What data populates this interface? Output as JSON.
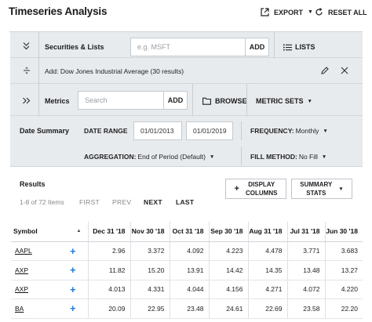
{
  "header": {
    "title": "Timeseries Analysis",
    "export_label": "EXPORT",
    "reset_label": "RESET ALL"
  },
  "securities": {
    "label": "Securities & Lists",
    "input_placeholder": "e.g. MSFT",
    "add_label": "ADD",
    "lists_label": "LISTS",
    "added_text": "Add: Dow Jones Industrial Average (30 results)"
  },
  "metrics": {
    "label": "Metrics",
    "search_placeholder": "Search",
    "add_label": "ADD",
    "browse_label": "BROWSE",
    "metric_sets_label": "METRIC SETS"
  },
  "date_summary": {
    "label": "Date Summary",
    "date_range_label": "DATE RANGE",
    "start_date": "01/01/2013",
    "end_date": "01/01/2019",
    "frequency_label": "FREQUENCY:",
    "frequency_value": "Monthly",
    "aggregation_label": "AGGREGATION:",
    "aggregation_value": "End of Period (Default)",
    "fill_method_label": "FILL METHOD:",
    "fill_method_value": "No Fill"
  },
  "results": {
    "title": "Results",
    "count_text": "1-8 of 72 Items",
    "first_label": "FIRST",
    "prev_label": "PREV",
    "next_label": "NEXT",
    "last_label": "LAST",
    "display_columns_line1": "DISPLAY",
    "display_columns_line2": "COLUMNS",
    "summary_stats_line1": "SUMMARY",
    "summary_stats_line2": "STATS"
  },
  "table": {
    "symbol_header": "Symbol",
    "columns": [
      "Dec 31 '18",
      "Nov 30 '18",
      "Oct 31 '18",
      "Sep 30 '18",
      "Aug 31 '18",
      "Jul 31 '18",
      "Jun 30 '18"
    ],
    "rows": [
      {
        "symbol": "AAPL",
        "values": [
          "2.96",
          "3.372",
          "4.092",
          "4.223",
          "4.478",
          "3.771",
          "3.683"
        ]
      },
      {
        "symbol": "AXP",
        "values": [
          "11.82",
          "15.20",
          "13.91",
          "14.42",
          "14.35",
          "13.48",
          "13.27"
        ]
      },
      {
        "symbol": "AXP",
        "values": [
          "4.013",
          "4.331",
          "4.044",
          "4.156",
          "4.271",
          "4.072",
          "4.220"
        ]
      },
      {
        "symbol": "BA",
        "values": [
          "20.09",
          "22.95",
          "23.48",
          "24.61",
          "22.69",
          "23.58",
          "22.20"
        ]
      }
    ]
  },
  "colors": {
    "panel_bg": "#e8ebee",
    "plus_accent": "#1f7ad6"
  }
}
